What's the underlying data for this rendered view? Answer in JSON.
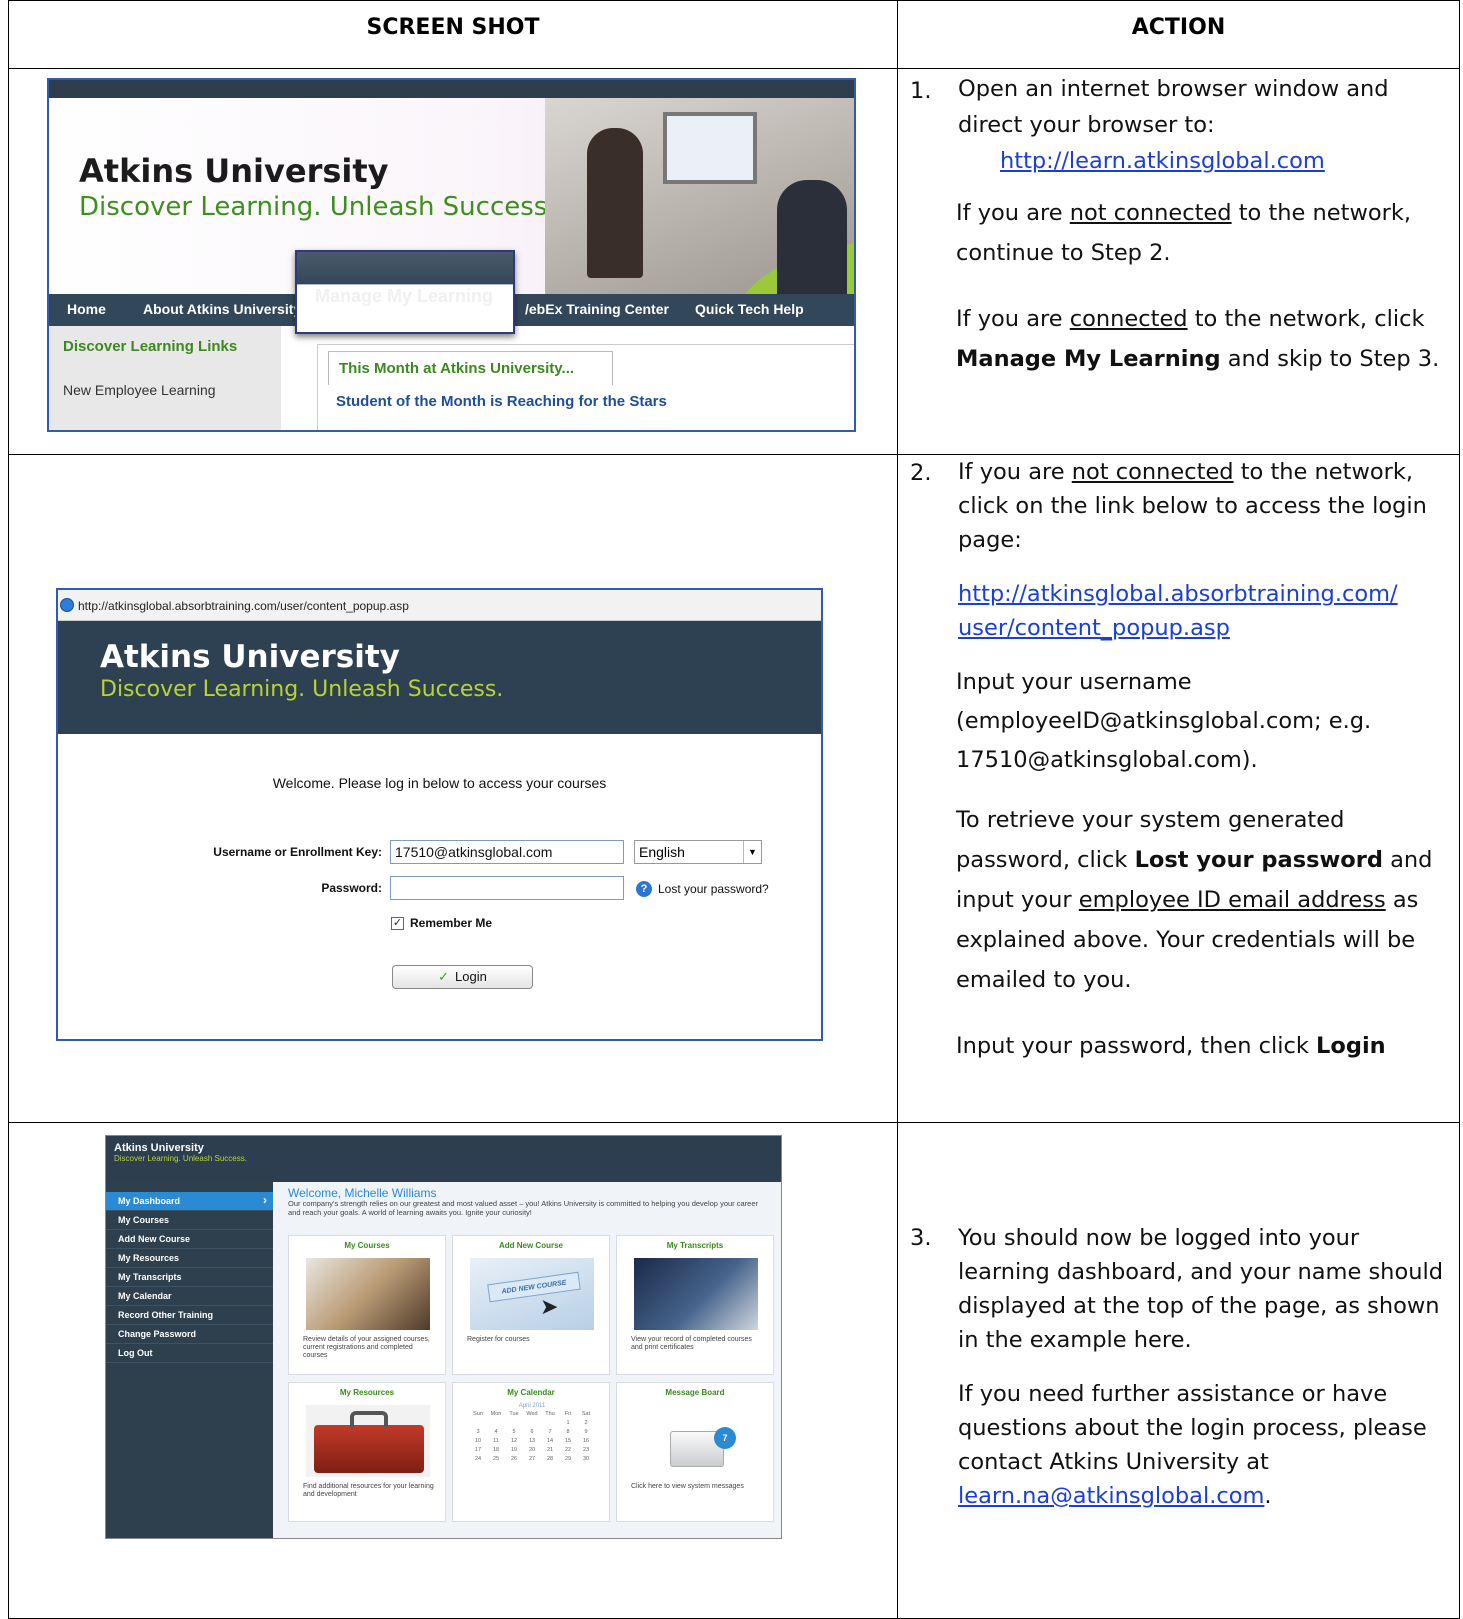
{
  "header": {
    "col1": "SCREEN SHOT",
    "col2": "ACTION"
  },
  "step1": {
    "number": "1.",
    "line1": "Open an internet browser window and direct your browser to:",
    "url": "http://learn.atkinsglobal.com",
    "p2_pre": "If you are ",
    "p2_u": "not connected",
    "p2_post": " to the network, continue to Step 2.",
    "p3_pre": "If you are ",
    "p3_u": "connected",
    "p3_mid": " to the network, click ",
    "p3_b": "Manage My Learning",
    "p3_post": " and skip to Step 3.",
    "shot": {
      "brand": "Atkins University",
      "tagline": "Discover Learning. Unleash Success.",
      "nav_home": "Home",
      "nav_about": "About Atkins University",
      "nav_manage": "Manage My Learning",
      "nav_webex": "WebEx Training Center",
      "nav_webex_visible": "/ebEx Training Center",
      "nav_help": "Quick Tech Help",
      "side_heading": "Discover Learning Links",
      "side_item": "New Employee Learning",
      "tab_label": "This Month at Atkins University...",
      "story": "Student of the Month is Reaching for the Stars"
    }
  },
  "step2": {
    "number": "2.",
    "p1_pre": "If you are ",
    "p1_u": "not connected",
    "p1_post": " to the network, click on the link below to access the login page:",
    "url_line1": "http://atkinsglobal.absorbtraining.com/",
    "url_line2": "user/content_popup.asp",
    "p3": "Input your username (employeeID@atkinsglobal.com; e.g. 17510@atkinsglobal.com).",
    "p4_pre": "To retrieve your system generated password, click ",
    "p4_b": "Lost your password",
    "p4_mid": " and input your ",
    "p4_u": "employee ID email address",
    "p4_post": " as explained above. Your credentials will be emailed to you.",
    "p5_pre": "Input your password, then click ",
    "p5_b": "Login",
    "shot": {
      "address": "http://atkinsglobal.absorbtraining.com/user/content_popup.asp",
      "brand": "Atkins University",
      "tagline": "Discover Learning. Unleash Success.",
      "welcome": "Welcome. Please log in below to access your courses",
      "username_label": "Username or Enrollment Key:",
      "username_value": "17510@atkinsglobal.com",
      "language": "English",
      "password_label": "Password:",
      "lost_password": "Lost your password?",
      "remember": "Remember Me",
      "login": "Login"
    }
  },
  "step3": {
    "number": "3.",
    "p1": "You should now be logged into your learning dashboard, and your name should displayed at the top of the page, as shown in the example here.",
    "p2": "If you need further assistance or have questions about the login process, please contact Atkins University at",
    "email": "learn.na@atkinsglobal.com",
    "email_suffix": ".",
    "shot": {
      "brand": "Atkins University",
      "tagline": "Discover Learning. Unleash Success.",
      "nav": [
        "My Dashboard",
        "My Courses",
        "Add New Course",
        "My Resources",
        "My Transcripts",
        "My Calendar",
        "Record Other Training",
        "Change Password",
        "Log Out"
      ],
      "welcome": "Welcome, Michelle Williams",
      "intro": "Our company's strength relies on our greatest and most valued asset – you! Atkins University is committed to helping you develop your career and reach your goals. A world of learning awaits you. Ignite your curiosity!",
      "tiles": [
        {
          "title": "My Courses",
          "desc": "Review details of your assigned courses, current registrations and completed courses"
        },
        {
          "title": "Add New Course",
          "desc": "Register for courses",
          "badge": "ADD NEW COURSE"
        },
        {
          "title": "My Transcripts",
          "desc": "View your record of completed courses and print certificates"
        },
        {
          "title": "My Resources",
          "desc": "Find additional resources for your learning and development"
        },
        {
          "title": "My Calendar",
          "desc": ""
        },
        {
          "title": "Message Board",
          "desc": "Click here to view system messages",
          "badge": "7"
        }
      ],
      "calendar": {
        "month": "April 2011",
        "days": [
          "Sun",
          "Mon",
          "Tue",
          "Wed",
          "Thu",
          "Fri",
          "Sat"
        ],
        "weeks": [
          [
            "",
            "",
            "",
            "",
            "",
            "1",
            "2"
          ],
          [
            "3",
            "4",
            "5",
            "6",
            "7",
            "8",
            "9"
          ],
          [
            "10",
            "11",
            "12",
            "13",
            "14",
            "15",
            "16"
          ],
          [
            "17",
            "18",
            "19",
            "20",
            "21",
            "22",
            "23"
          ],
          [
            "24",
            "25",
            "26",
            "27",
            "28",
            "29",
            "30"
          ]
        ]
      }
    }
  }
}
